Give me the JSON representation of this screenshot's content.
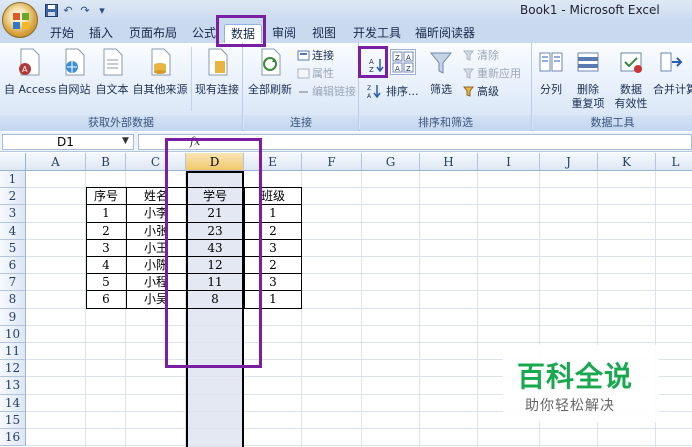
{
  "window": {
    "title": "Book1 - Microsoft Excel"
  },
  "quick_access": {
    "icons": [
      "save-icon",
      "undo-icon",
      "redo-icon",
      "customize-qat-icon"
    ],
    "labels": [
      "",
      "↶",
      "↷",
      "▾"
    ]
  },
  "tabs": [
    {
      "label": "开始",
      "active": false
    },
    {
      "label": "插入",
      "active": false
    },
    {
      "label": "页面布局",
      "active": false
    },
    {
      "label": "公式",
      "active": false
    },
    {
      "label": "数据",
      "active": true
    },
    {
      "label": "审阅",
      "active": false
    },
    {
      "label": "视图",
      "active": false
    },
    {
      "label": "开发工具",
      "active": false
    },
    {
      "label": "福昕阅读器",
      "active": false
    }
  ],
  "ribbon": {
    "get_external": {
      "label": "获取外部数据",
      "access": "自 Access",
      "web": "自网站",
      "text": "自文本",
      "other": "自其他来源",
      "existing": "现有连接"
    },
    "connections": {
      "label": "连接",
      "refresh_all": "全部刷新",
      "connections": "连接",
      "properties": "属性",
      "edit_links": "编辑链接"
    },
    "sort_filter": {
      "label": "排序和筛选",
      "sort_az": "A↓Z",
      "sort_za": "Z↓A",
      "sort": "排序...",
      "filter": "筛选",
      "clear": "清除",
      "reapply": "重新应用",
      "advanced": "高级"
    },
    "data_tools": {
      "label": "数据工具",
      "text_to_columns": "分列",
      "remove_dup_1": "删除",
      "remove_dup_2": "重复项",
      "validation_1": "数据",
      "validation_2": "有效性",
      "consolidate": "合并计算"
    }
  },
  "formula_bar": {
    "name_box": "D1",
    "fx_label": "fx",
    "formula": ""
  },
  "columns": [
    "A",
    "B",
    "C",
    "D",
    "E",
    "F",
    "G",
    "H",
    "I",
    "J",
    "K",
    "L"
  ],
  "selected_column": "D",
  "rows": [
    "1",
    "2",
    "3",
    "4",
    "5",
    "6",
    "7",
    "8",
    "9",
    "10",
    "11",
    "12",
    "13",
    "14",
    "15",
    "16"
  ],
  "table": {
    "headers": [
      "序号",
      "姓名",
      "学号",
      "班级"
    ],
    "rows": [
      [
        "1",
        "小李",
        "21",
        "1"
      ],
      [
        "2",
        "小张",
        "23",
        "2"
      ],
      [
        "3",
        "小王",
        "43",
        "3"
      ],
      [
        "4",
        "小陈",
        "12",
        "2"
      ],
      [
        "5",
        "小程",
        "11",
        "3"
      ],
      [
        "6",
        "小吴",
        "8",
        "1"
      ]
    ]
  },
  "watermark": {
    "title": "百科全说",
    "subtitle": "助你轻松解决"
  },
  "colors": {
    "highlight": "#7a1fa2",
    "selected_column_fill": "#e3e8f2",
    "watermark_green": "#18a84f"
  }
}
